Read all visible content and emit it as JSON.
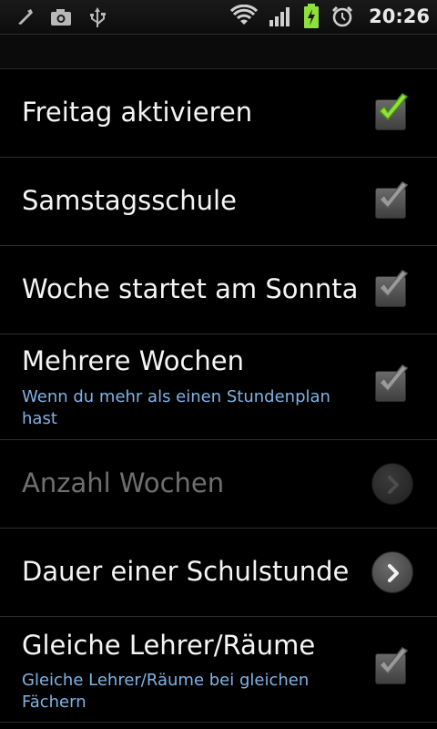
{
  "status_bar": {
    "time": "20:26",
    "icons": [
      "usb-debug-icon",
      "camera-icon",
      "usb-icon",
      "wifi-icon",
      "signal-icon",
      "battery-charging-icon",
      "alarm-icon"
    ]
  },
  "settings": [
    {
      "title": "Freitag aktivieren",
      "type": "checkbox",
      "checked": true,
      "enabled": true
    },
    {
      "title": "Samstagsschule",
      "type": "checkbox",
      "checked": true,
      "enabled": true
    },
    {
      "title": "Woche startet am Sonnta",
      "type": "checkbox",
      "checked": true,
      "enabled": true
    },
    {
      "title": "Mehrere Wochen",
      "subtitle": "Wenn du mehr als einen Stundenplan hast",
      "type": "checkbox",
      "checked": true,
      "enabled": true
    },
    {
      "title": "Anzahl Wochen",
      "type": "chevron",
      "enabled": false
    },
    {
      "title": "Dauer einer Schulstunde",
      "type": "chevron",
      "enabled": true
    },
    {
      "title": "Gleiche Lehrer/Räume",
      "subtitle": "Gleiche Lehrer/Räume bei gleichen Fächern",
      "type": "checkbox",
      "checked": true,
      "enabled": true
    }
  ],
  "colors": {
    "check_active": "#8ee03a",
    "check_inactive": "#9a9a9a",
    "subtitle": "#7fb3e6"
  }
}
